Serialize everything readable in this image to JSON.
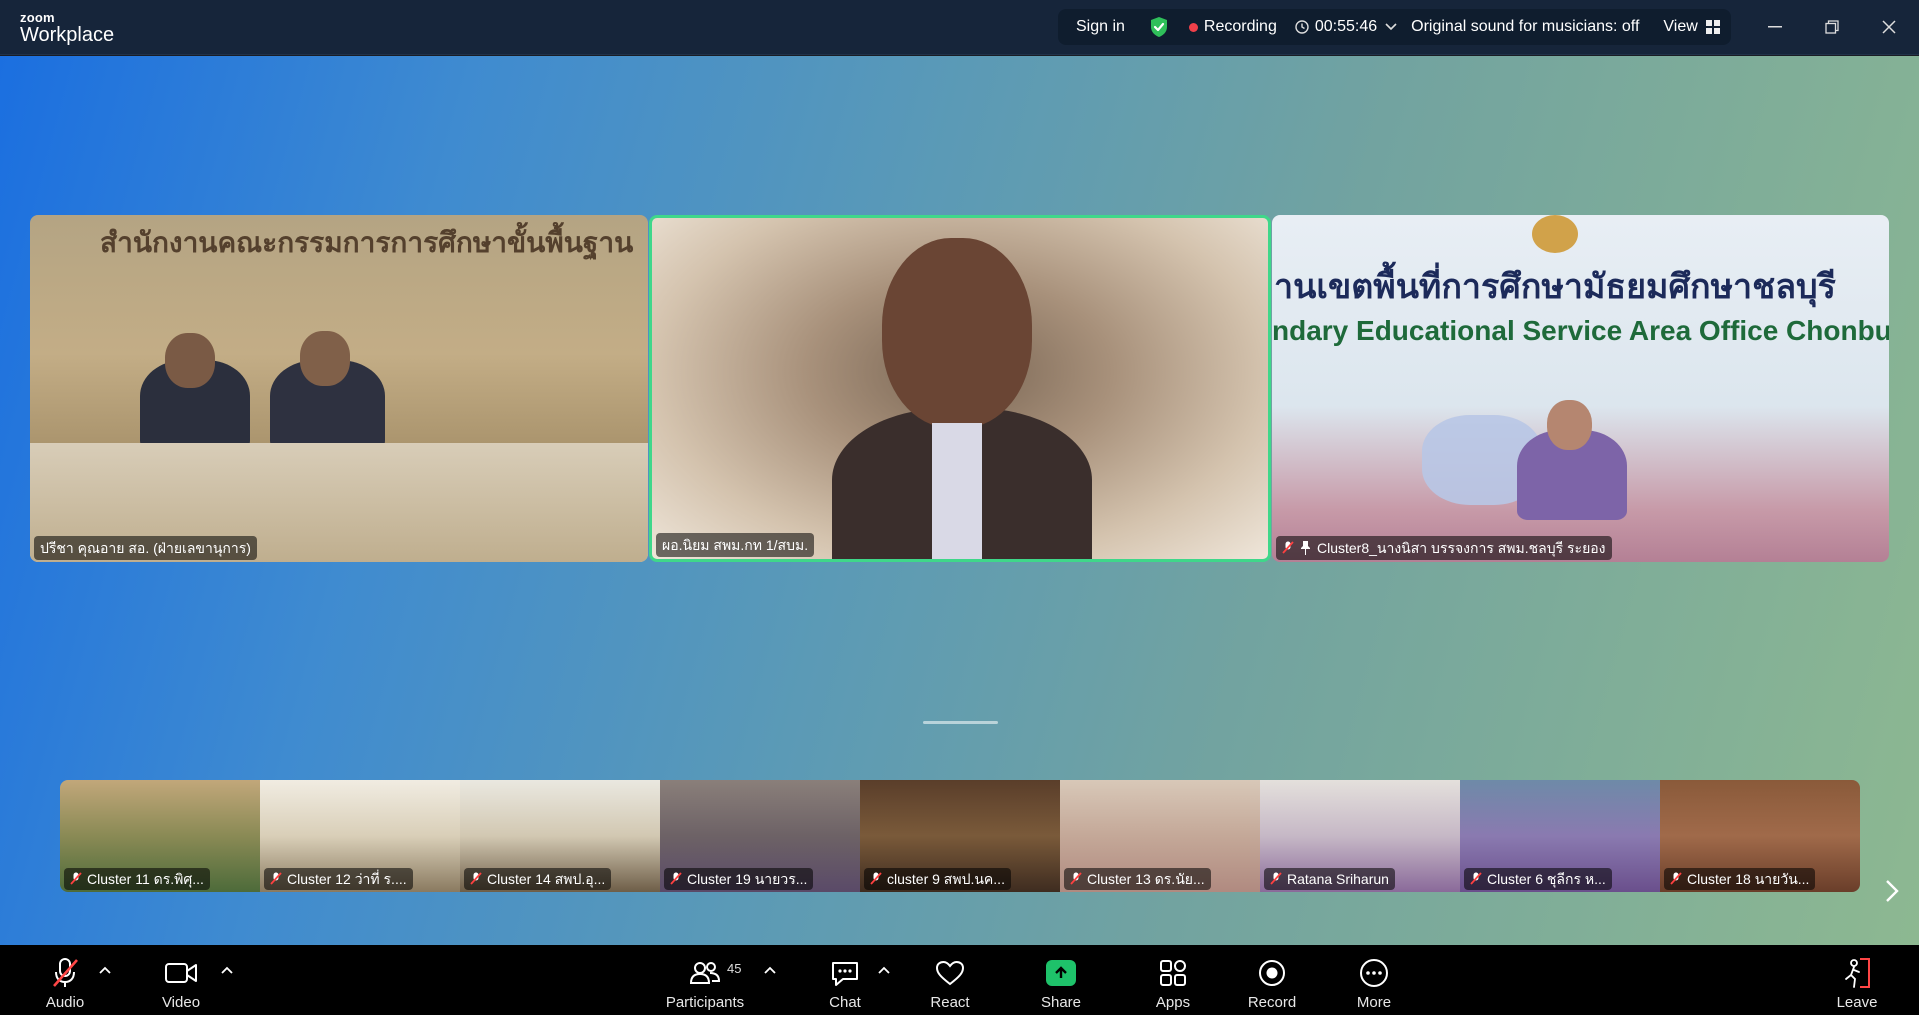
{
  "app": {
    "brand_small": "zoom",
    "brand_large": "Workplace"
  },
  "status": {
    "sign_in": "Sign in",
    "shield_icon": "shield-check-icon",
    "recording_label": "Recording",
    "timer": "00:55:46",
    "original_sound": "Original sound for musicians: off",
    "view_label": "View"
  },
  "colors": {
    "active_speaker": "#3fd78a",
    "share_green": "#1ec26a",
    "recording_red": "#f0404a"
  },
  "main_tiles": [
    {
      "name": "ปรีชา  คุณอาย สอ. (ฝ่ายเลขานุการ)",
      "backdrop_text": "สำนักงานคณะกรรมการการศึกษาขั้นพื้นฐาน",
      "muted": false,
      "pinned": false
    },
    {
      "name": "ผอ.นิยม สพม.กท 1/สบม.",
      "muted": false,
      "pinned": false,
      "active": true
    },
    {
      "name": "Cluster8_นางนิสา บรรจงการ สพม.ชลบุรี ระยอง",
      "backdrop_text_th": "านเขตพื้นที่การศึกษามัธยมศึกษาชลบุรี",
      "backdrop_text_en": "ndary Educational Service Area Office Chonburi",
      "muted": true,
      "pinned": true
    }
  ],
  "strip": [
    {
      "name": "Cluster 11 ดร.พิศุ...",
      "muted": true
    },
    {
      "name": "Cluster 12 ว่าที่ ร....",
      "muted": true
    },
    {
      "name": "Cluster 14 สพป.อุ...",
      "muted": true
    },
    {
      "name": "Cluster 19 นายวร...",
      "muted": true
    },
    {
      "name": "cluster 9 สพป.นค...",
      "muted": true
    },
    {
      "name": "Cluster 13 ดร.นัย...",
      "muted": true
    },
    {
      "name": "Ratana Sriharun",
      "muted": true
    },
    {
      "name": "Cluster 6 ชุลีกร  ห...",
      "muted": true
    },
    {
      "name": "Cluster 18 นายวัน...",
      "muted": true
    }
  ],
  "toolbar": {
    "audio": "Audio",
    "video": "Video",
    "participants": "Participants",
    "participants_count": "45",
    "chat": "Chat",
    "react": "React",
    "share": "Share",
    "apps": "Apps",
    "record": "Record",
    "more": "More",
    "leave": "Leave"
  }
}
